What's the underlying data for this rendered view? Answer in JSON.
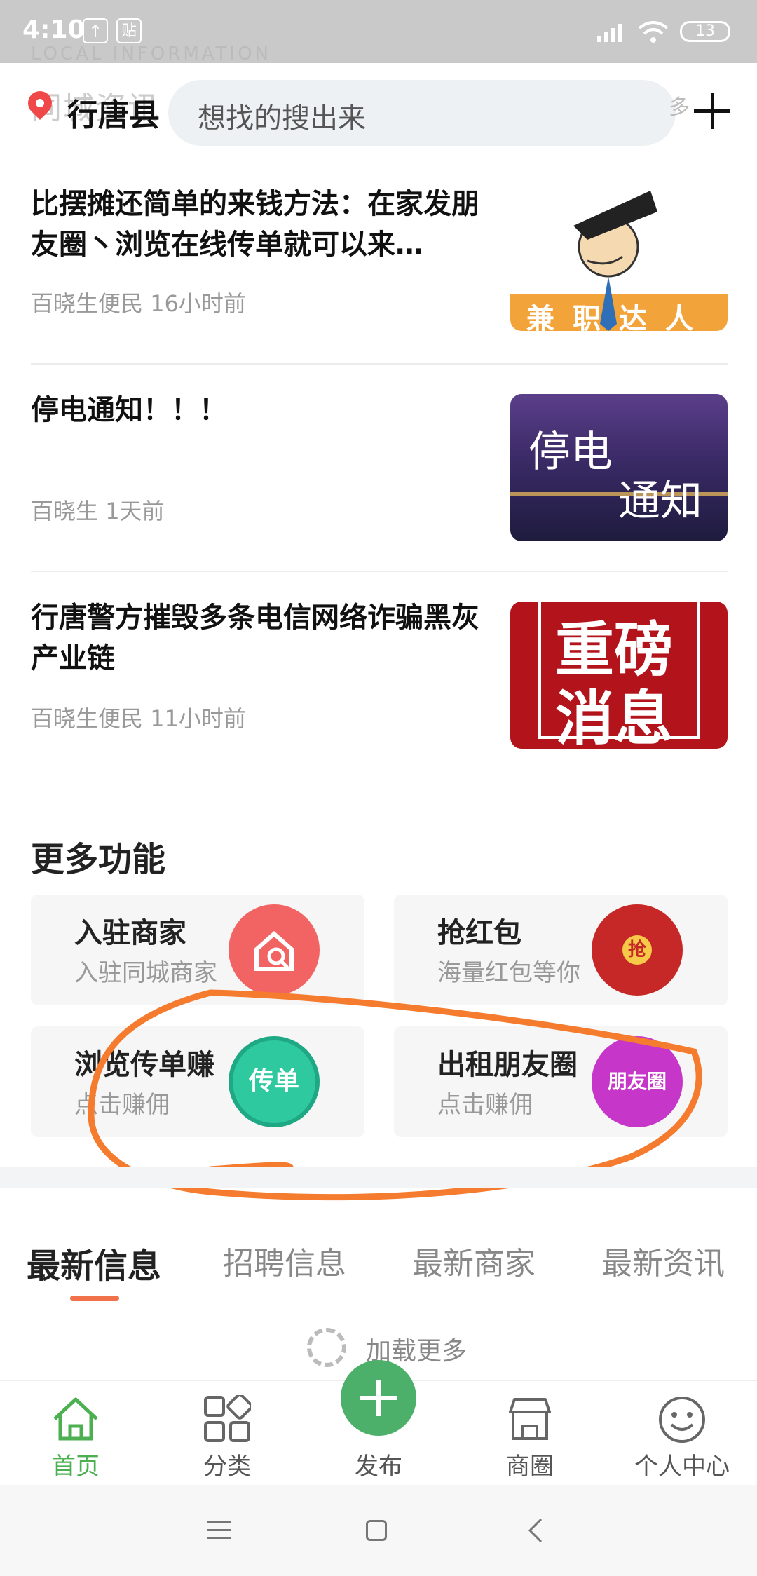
{
  "status_bar": {
    "time": "4:10",
    "icon_upload": "↑",
    "icon_paste": "贴",
    "battery": "13"
  },
  "header": {
    "faded_section_en": "LOCAL INFORMATION",
    "faded_section_cn": "同城资讯",
    "city": "行唐县",
    "search_placeholder": "想找的搜出来",
    "faded_more": "多"
  },
  "news": [
    {
      "title": "比摆摊还简单的来钱方法：在家发朋友圈丶浏览在线传单就可以来…",
      "author": "百晓生便民",
      "time": "16小时前",
      "thumb_text": "兼职达人"
    },
    {
      "title": "停电通知！！！",
      "author": "百晓生",
      "time": "1天前",
      "thumb_text_1": "停电",
      "thumb_text_2": "通知"
    },
    {
      "title": "行唐警方摧毁多条电信网络诈骗黑灰产业链",
      "author": "百晓生便民",
      "time": "11小时前",
      "thumb_text_1": "重磅",
      "thumb_text_2": "消息"
    }
  ],
  "more_functions": {
    "title": "更多功能",
    "cards": [
      {
        "title": "入驻商家",
        "subtitle": "入驻同城商家",
        "icon": "store-search-icon",
        "color": "#f26464"
      },
      {
        "title": "抢红包",
        "subtitle": "海量红包等你",
        "icon": "red-envelope-icon",
        "icon_text": "抢",
        "color": "#c62828"
      },
      {
        "title": "浏览传单赚",
        "subtitle": "点击赚佣",
        "icon": "flyer-icon",
        "icon_text": "传单",
        "color": "#2fc9a0"
      },
      {
        "title": "出租朋友圈",
        "subtitle": "点击赚佣",
        "icon": "moments-icon",
        "icon_text": "朋友圈",
        "color": "#c637c9"
      }
    ]
  },
  "tabs": [
    "最新信息",
    "招聘信息",
    "最新商家",
    "最新资讯"
  ],
  "loading_text": "加载更多",
  "bottom_nav": [
    "首页",
    "分类",
    "发布",
    "商圈",
    "个人中心"
  ],
  "colors": {
    "accent_green": "#4caf50",
    "annotation_orange": "#f57c2e",
    "tab_indicator": "#f0714a"
  }
}
